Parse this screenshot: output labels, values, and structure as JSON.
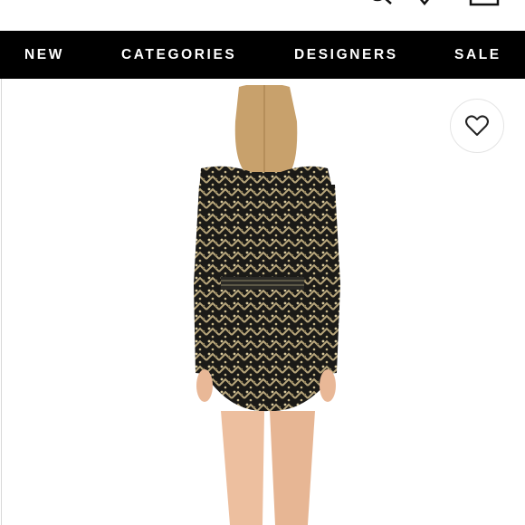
{
  "nav": {
    "items": [
      {
        "label": "NEW"
      },
      {
        "label": "CATEGORIES"
      },
      {
        "label": "DESIGNERS"
      },
      {
        "label": "SALE"
      }
    ]
  },
  "product": {
    "image_description": "model-back-view-sequin-dress"
  },
  "icons": {
    "menu": "menu-icon",
    "search": "search-icon",
    "heart": "heart-icon",
    "bag": "shopping-bag-icon"
  },
  "colors": {
    "nav_background": "#000000",
    "nav_text": "#ffffff"
  }
}
